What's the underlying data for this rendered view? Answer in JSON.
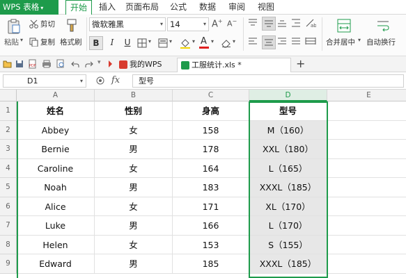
{
  "menubar": {
    "app_label": "WPS 表格",
    "items": [
      "开始",
      "插入",
      "页面布局",
      "公式",
      "数据",
      "审阅",
      "视图"
    ],
    "active_index": 0
  },
  "ribbon": {
    "paste_label": "粘贴",
    "cut_label": "剪切",
    "copy_label": "复制",
    "format_painter_label": "格式刷",
    "font_name": "微软雅黑",
    "font_size": "14",
    "merge_center_label": "合并居中",
    "wrap_text_label": "自动换行",
    "bold_label": "B",
    "italic_label": "I",
    "underline_label": "U",
    "font_color_label": "A",
    "grow_font_label": "A",
    "shrink_font_label": "A",
    "font_color_hex": "#e02020"
  },
  "tabs": [
    {
      "label": "我的WPS",
      "active": false,
      "color": "#d83b2f"
    },
    {
      "label": "工服统计.xls *",
      "active": true,
      "color": "#1e9b4b"
    }
  ],
  "add_tab_label": "+",
  "formula_bar": {
    "name_box": "D1",
    "fx_label": "fx",
    "value": "型号"
  },
  "sheet": {
    "columns": [
      "A",
      "B",
      "C",
      "D",
      "E"
    ],
    "selected_column": "D",
    "row_numbers": [
      "1",
      "2",
      "3",
      "4",
      "5",
      "6",
      "7",
      "8",
      "9"
    ],
    "header_row": [
      "姓名",
      "性别",
      "身高",
      "型号"
    ],
    "rows": [
      [
        "Abbey",
        "女",
        "158",
        "M（160）"
      ],
      [
        "Bernie",
        "男",
        "178",
        "XXL（180）"
      ],
      [
        "Caroline",
        "女",
        "164",
        "L（165）"
      ],
      [
        "Noah",
        "男",
        "183",
        "XXXL（185）"
      ],
      [
        "Alice",
        "女",
        "171",
        "XL（170）"
      ],
      [
        "Luke",
        "男",
        "166",
        "L（170）"
      ],
      [
        "Helen",
        "女",
        "153",
        "S（155）"
      ],
      [
        "Edward",
        "男",
        "185",
        "XXXL（185）"
      ]
    ],
    "accent": "#1e9b4b"
  }
}
